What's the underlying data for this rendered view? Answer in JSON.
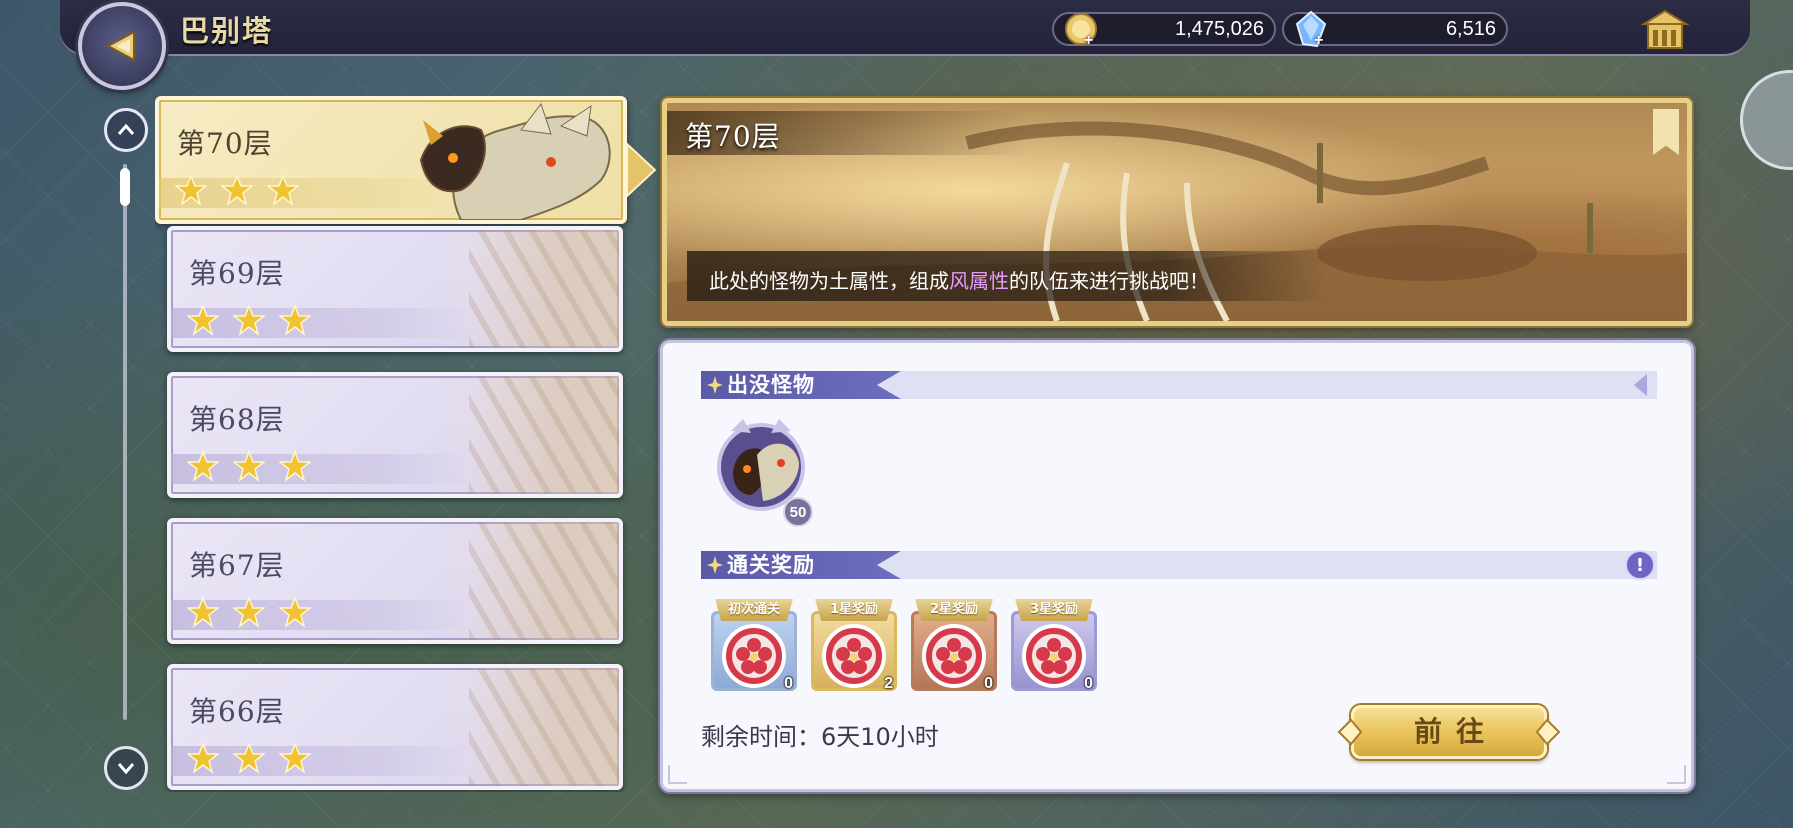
{
  "header": {
    "title": "巴别塔",
    "gold": "1,475,026",
    "gem": "6,516"
  },
  "floors": [
    {
      "label": "第70层",
      "stars": 3,
      "selected": true
    },
    {
      "label": "第69层",
      "stars": 3,
      "selected": false
    },
    {
      "label": "第68层",
      "stars": 3,
      "selected": false
    },
    {
      "label": "第67层",
      "stars": 3,
      "selected": false
    },
    {
      "label": "第66层",
      "stars": 3,
      "selected": false
    }
  ],
  "stage": {
    "title": "第70层",
    "hint_before": "此处的怪物为土属性，组成",
    "hint_accent": "风属性",
    "hint_after": "的队伍来进行挑战吧！"
  },
  "monsters_section": {
    "label": "出没怪物",
    "monster_level": "50"
  },
  "rewards_section": {
    "label": "通关奖励",
    "items": [
      {
        "ribbon": "初次通关",
        "qty": "0",
        "frame": "blue"
      },
      {
        "ribbon": "1星奖励",
        "qty": "2",
        "frame": "gold"
      },
      {
        "ribbon": "2星奖励",
        "qty": "0",
        "frame": "bronze"
      },
      {
        "ribbon": "3星奖励",
        "qty": "0",
        "frame": "violet"
      }
    ]
  },
  "remaining_time": "剩余时间：6天10小时",
  "go_button": "前往",
  "colors": {
    "accent_purple": "#e69cff",
    "section_header": "#5a5aa7",
    "button_gold": "#e8c25b",
    "star": "#f2c331"
  },
  "icons": [
    "back-arrow-icon",
    "gold-coin-icon",
    "crystal-gem-icon",
    "home-icon",
    "chevron-up-icon",
    "chevron-down-icon",
    "star-icon",
    "info-icon",
    "sparkle-icon"
  ]
}
